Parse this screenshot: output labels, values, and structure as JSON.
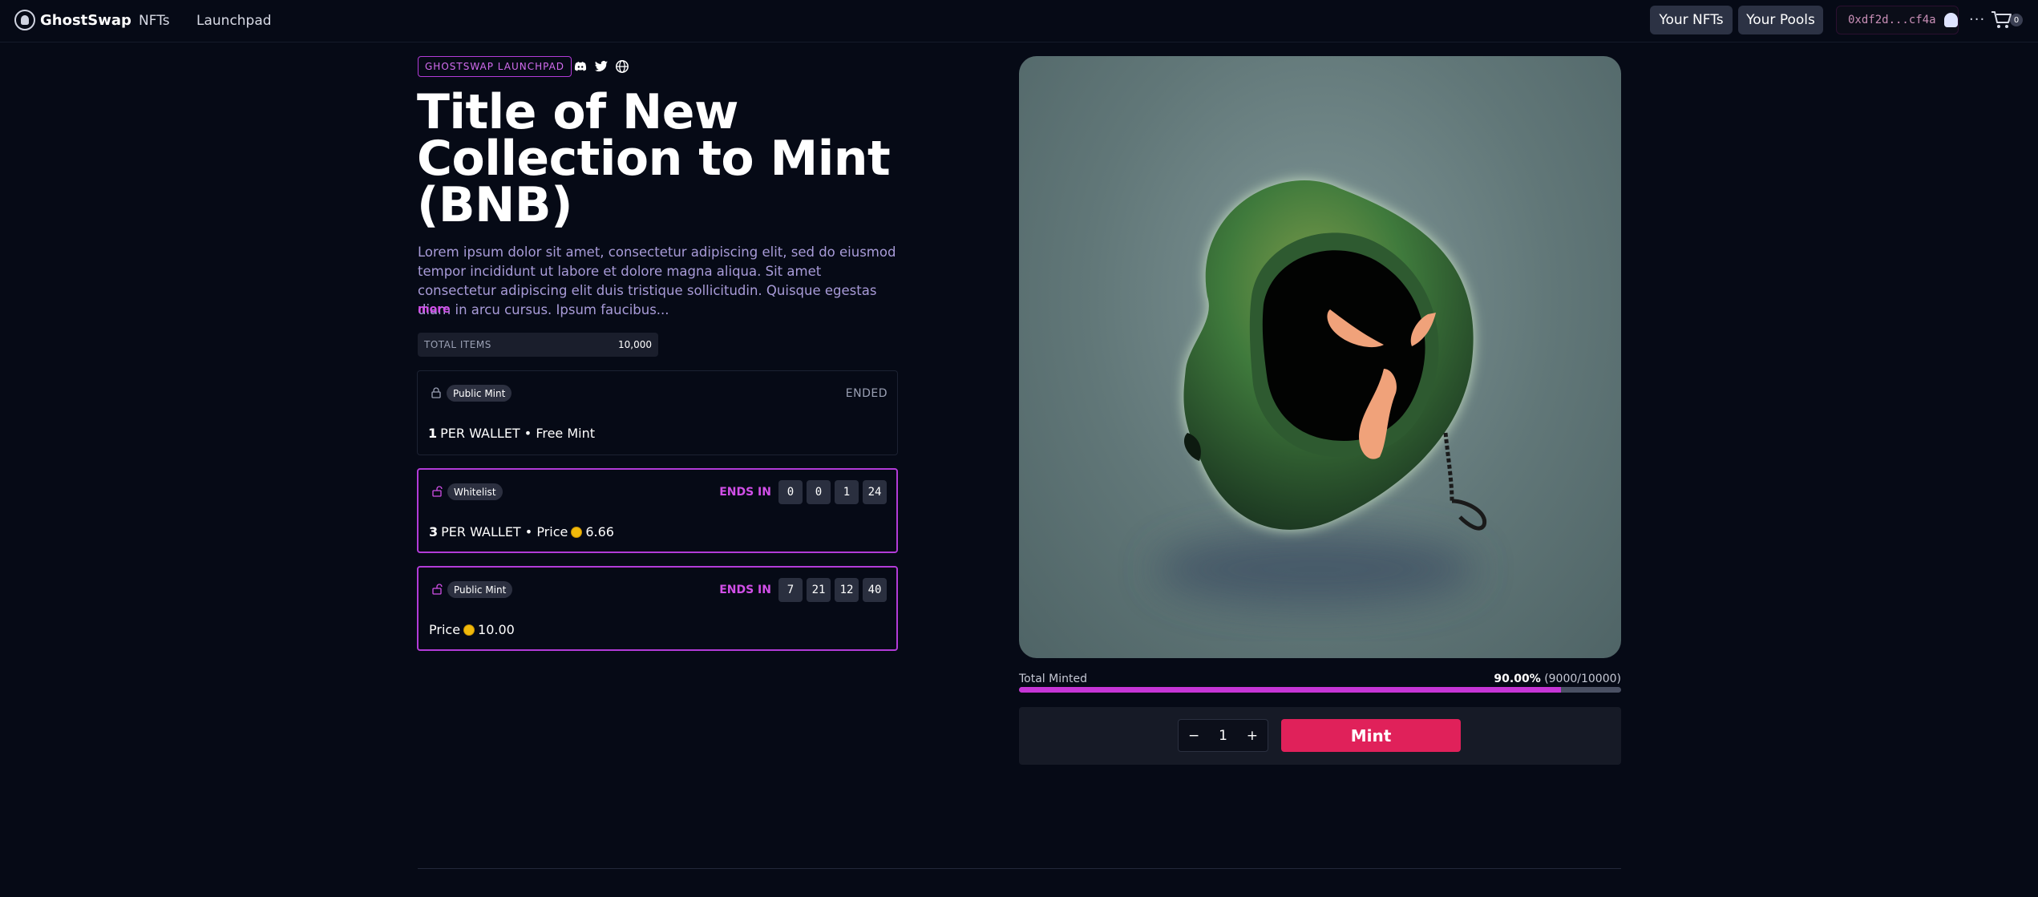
{
  "header": {
    "brand": "GhostSwap",
    "nav": [
      {
        "label": "NFTs"
      },
      {
        "label": "Launchpad"
      }
    ],
    "your_nfts": "Your NFTs",
    "your_pools": "Your Pools",
    "wallet_address": "0xdf2d...cf4a",
    "more_label": "···",
    "cart_count": "0"
  },
  "collection": {
    "tag": "GHOSTSWAP LAUNCHPAD",
    "title": "Title of New Collection to Mint (BNB)",
    "description": "Lorem ipsum dolor sit amet, consectetur adipiscing elit, sed do eiusmod tempor incididunt ut labore et dolore magna aliqua. Sit amet consectetur adipiscing elit duis tristique sollicitudin. Quisque egestas diam in arcu cursus. Ipsum faucibus...",
    "more_label": "more",
    "total_items_label": "TOTAL ITEMS",
    "total_items_value": "10,000"
  },
  "phases": [
    {
      "name": "Public Mint",
      "status": "ENDED",
      "per_wallet": "1",
      "line": "PER WALLET • Free Mint"
    },
    {
      "name": "Whitelist",
      "ends_label": "ENDS IN",
      "countdown": [
        "0",
        "0",
        "1",
        "24"
      ],
      "per_wallet": "3",
      "line_prefix": "PER WALLET • Price",
      "price": "6.66"
    },
    {
      "name": "Public Mint",
      "ends_label": "ENDS IN",
      "countdown": [
        "7",
        "21",
        "12",
        "40"
      ],
      "line_prefix": "Price",
      "price": "10.00"
    }
  ],
  "mint": {
    "total_minted_label": "Total Minted",
    "percent": "90.00%",
    "count": "(9000/10000)",
    "progress": 0.9,
    "quantity": "1",
    "minus": "−",
    "plus": "+",
    "button": "Mint"
  },
  "colors": {
    "background": "#060a16",
    "accent_purple": "#b23bd8",
    "mint_button": "#e0215a",
    "progress_fill": "#c535d6"
  }
}
